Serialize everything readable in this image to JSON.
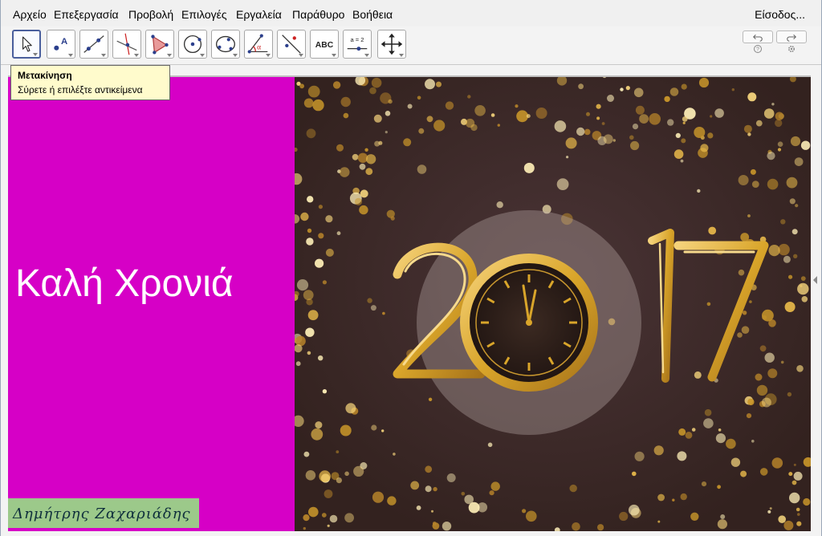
{
  "menu": {
    "items": [
      "Αρχείο",
      "Επεξεργασία",
      "Προβολή",
      "Επιλογές",
      "Εργαλεία",
      "Παράθυρο",
      "Βοήθεια"
    ],
    "login": "Είσοδος..."
  },
  "toolbar": {
    "tools": [
      {
        "icon": "move-arrow-icon"
      },
      {
        "icon": "point-icon",
        "label": "A"
      },
      {
        "icon": "line-icon"
      },
      {
        "icon": "perpendicular-line-icon"
      },
      {
        "icon": "polygon-icon"
      },
      {
        "icon": "circle-center-icon"
      },
      {
        "icon": "circle-three-points-icon"
      },
      {
        "icon": "angle-icon",
        "label": "α"
      },
      {
        "icon": "reflect-icon"
      },
      {
        "icon": "text-icon",
        "label": "ABC"
      },
      {
        "icon": "slider-icon",
        "label": "a = 2"
      },
      {
        "icon": "move-graphics-icon"
      }
    ],
    "undo_icon": "undo-icon",
    "redo_icon": "redo-icon",
    "help_icon": "help-icon",
    "settings_icon": "gear-icon"
  },
  "tooltip": {
    "title": "Μετακίνηση",
    "description": "Σύρετε ή επιλέξτε αντικείμενα"
  },
  "canvas": {
    "greeting": "Καλή Χρονιά",
    "signature": "Δημήτρης Ζαχαριάδης",
    "image_year": "2017",
    "background_color": "#d600c6",
    "signature_bg": "#9cc98a",
    "photo_bg": "#3f2a2d",
    "gold": "#d9a52a"
  }
}
